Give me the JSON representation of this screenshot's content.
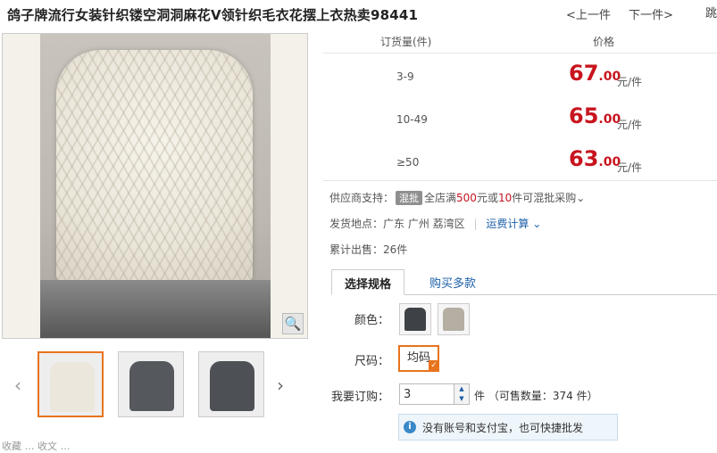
{
  "product": {
    "title": "鸽子牌流行女装针织镂空洞洞麻花V领针织毛衣花摆上衣热卖98441"
  },
  "nav": {
    "prev_label": "<上一件",
    "next_label": "下一件>",
    "jump_label": "跳"
  },
  "price_table": {
    "qty_header": "订货量(件)",
    "price_header": "价格",
    "rows": [
      {
        "qty": "3-9",
        "price_int": "67",
        "price_dec": ".00",
        "unit": "元/件"
      },
      {
        "qty": "10-49",
        "price_int": "65",
        "price_dec": ".00",
        "unit": "元/件"
      },
      {
        "qty": "≥50",
        "price_int": "63",
        "price_dec": ".00",
        "unit": "元/件"
      }
    ]
  },
  "supplier": {
    "label": "供应商支持：",
    "badge": "混批",
    "text_a": "全店满",
    "amount": "500",
    "text_b": "元或",
    "count": "10",
    "text_c": "件可混批采购",
    "chevron": "⌄"
  },
  "shipping": {
    "label": "发货地点：",
    "location": "广东 广州 荔湾区",
    "divider": "|",
    "freight_link": "运费计算",
    "chevron": "⌄"
  },
  "sold": {
    "label": "累计出售：",
    "value": "26件"
  },
  "tabs": [
    {
      "label": "选择规格"
    },
    {
      "label": "购买多款"
    }
  ],
  "spec": {
    "color_label": "颜色：",
    "size_label": "尺码：",
    "size_value": "均码",
    "order_label": "我要订购：",
    "quantity": "3",
    "unit": "件",
    "stock_text": "（可售数量：374 件）"
  },
  "notice": {
    "icon": "i",
    "text": "没有账号和支付宝，也可快捷批发"
  },
  "zoom_icon": "🔍",
  "thumb_nav": {
    "left": "‹",
    "right": "›"
  },
  "bottom": {
    "text": "收藏  …  收文 …"
  },
  "colors": {
    "price_red": "#c8141e",
    "accent_orange": "#e8731c",
    "link_blue": "#1c5fa8"
  }
}
